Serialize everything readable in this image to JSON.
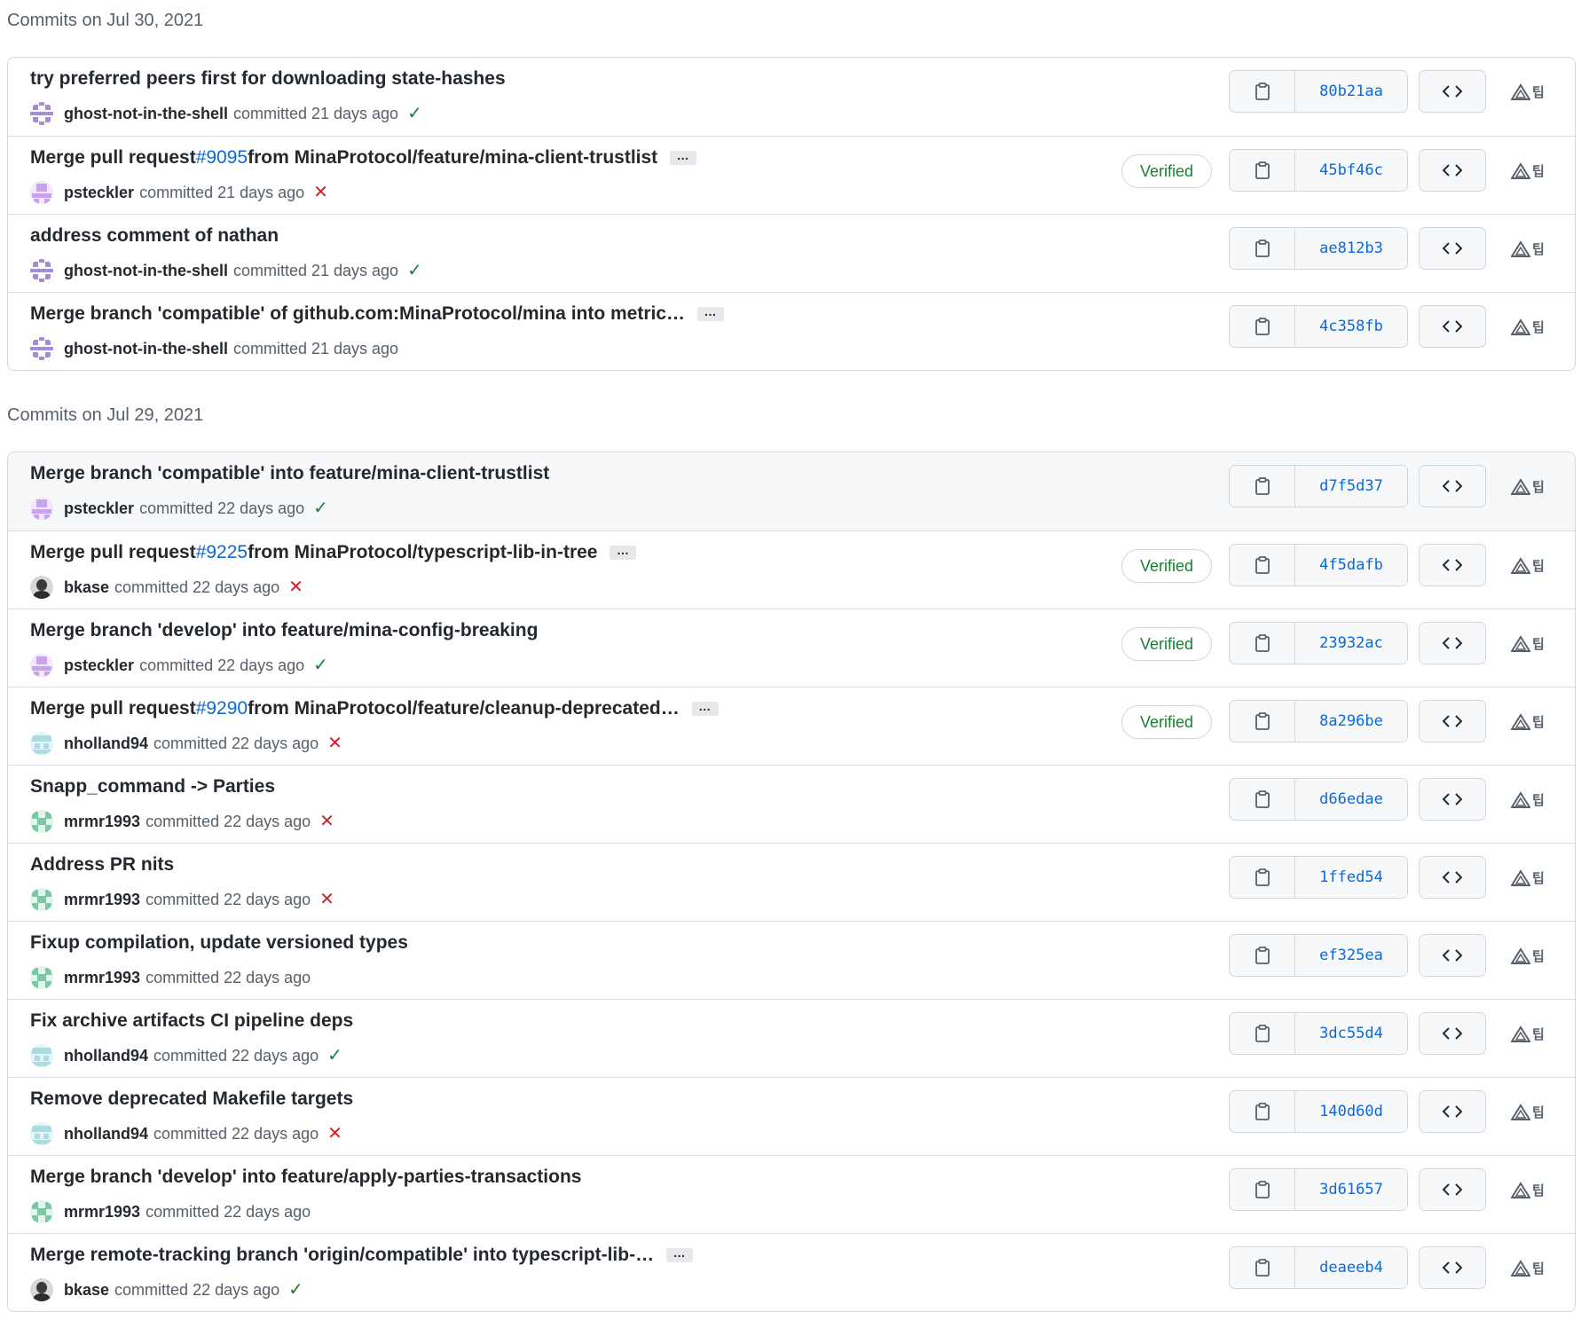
{
  "groups": [
    {
      "header": "Commits on Jul 30, 2021",
      "commits": [
        {
          "pre": "try preferred peers first for downloading state-hashes",
          "link": "",
          "post": "",
          "ellipsis": false,
          "author": "ghost-not-in-the-shell",
          "avatar": "ghost",
          "time": "committed 21 days ago",
          "status": "ok",
          "verified": false,
          "sha": "80b21aa",
          "highlight": false
        },
        {
          "pre": "Merge pull request ",
          "link": "#9095",
          "post": " from MinaProtocol/feature/mina-client-trustlist",
          "ellipsis": true,
          "author": "psteckler",
          "avatar": "psteck",
          "time": "committed 21 days ago",
          "status": "fail",
          "verified": true,
          "sha": "45bf46c",
          "highlight": false
        },
        {
          "pre": "address comment of nathan",
          "link": "",
          "post": "",
          "ellipsis": false,
          "author": "ghost-not-in-the-shell",
          "avatar": "ghost",
          "time": "committed 21 days ago",
          "status": "ok",
          "verified": false,
          "sha": "ae812b3",
          "highlight": false
        },
        {
          "pre": "Merge branch 'compatible' of github.com:MinaProtocol/mina into metric…",
          "link": "",
          "post": "",
          "ellipsis": true,
          "author": "ghost-not-in-the-shell",
          "avatar": "ghost",
          "time": "committed 21 days ago",
          "status": "none",
          "verified": false,
          "sha": "4c358fb",
          "highlight": false
        }
      ]
    },
    {
      "header": "Commits on Jul 29, 2021",
      "commits": [
        {
          "pre": "Merge branch 'compatible' into feature/mina-client-trustlist",
          "link": "",
          "post": "",
          "ellipsis": false,
          "author": "psteckler",
          "avatar": "psteck",
          "time": "committed 22 days ago",
          "status": "ok",
          "verified": false,
          "sha": "d7f5d37",
          "highlight": true
        },
        {
          "pre": "Merge pull request ",
          "link": "#9225",
          "post": " from MinaProtocol/typescript-lib-in-tree",
          "ellipsis": true,
          "author": "bkase",
          "avatar": "bkase",
          "time": "committed 22 days ago",
          "status": "fail",
          "verified": true,
          "sha": "4f5dafb",
          "highlight": false
        },
        {
          "pre": "Merge branch 'develop' into feature/mina-config-breaking",
          "link": "",
          "post": "",
          "ellipsis": false,
          "author": "psteckler",
          "avatar": "psteck",
          "time": "committed 22 days ago",
          "status": "ok",
          "verified": true,
          "sha": "23932ac",
          "highlight": false
        },
        {
          "pre": "Merge pull request ",
          "link": "#9290",
          "post": " from MinaProtocol/feature/cleanup-deprecated…",
          "ellipsis": true,
          "author": "nholland94",
          "avatar": "nholl",
          "time": "committed 22 days ago",
          "status": "fail",
          "verified": true,
          "sha": "8a296be",
          "highlight": false
        },
        {
          "pre": "Snapp_command -> Parties",
          "link": "",
          "post": "",
          "ellipsis": false,
          "author": "mrmr1993",
          "avatar": "mrmr",
          "time": "committed 22 days ago",
          "status": "fail",
          "verified": false,
          "sha": "d66edae",
          "highlight": false
        },
        {
          "pre": "Address PR nits",
          "link": "",
          "post": "",
          "ellipsis": false,
          "author": "mrmr1993",
          "avatar": "mrmr",
          "time": "committed 22 days ago",
          "status": "fail",
          "verified": false,
          "sha": "1ffed54",
          "highlight": false
        },
        {
          "pre": "Fixup compilation, update versioned types",
          "link": "",
          "post": "",
          "ellipsis": false,
          "author": "mrmr1993",
          "avatar": "mrmr",
          "time": "committed 22 days ago",
          "status": "none",
          "verified": false,
          "sha": "ef325ea",
          "highlight": false
        },
        {
          "pre": "Fix archive artifacts CI pipeline deps",
          "link": "",
          "post": "",
          "ellipsis": false,
          "author": "nholland94",
          "avatar": "nholl",
          "time": "committed 22 days ago",
          "status": "ok",
          "verified": false,
          "sha": "3dc55d4",
          "highlight": false
        },
        {
          "pre": "Remove deprecated Makefile targets",
          "link": "",
          "post": "",
          "ellipsis": false,
          "author": "nholland94",
          "avatar": "nholl",
          "time": "committed 22 days ago",
          "status": "fail",
          "verified": false,
          "sha": "140d60d",
          "highlight": false
        },
        {
          "pre": "Merge branch 'develop' into feature/apply-parties-transactions",
          "link": "",
          "post": "",
          "ellipsis": false,
          "author": "mrmr1993",
          "avatar": "mrmr",
          "time": "committed 22 days ago",
          "status": "none",
          "verified": false,
          "sha": "3d61657",
          "highlight": false
        },
        {
          "pre": "Merge remote-tracking branch 'origin/compatible' into typescript-lib-…",
          "link": "",
          "post": "",
          "ellipsis": true,
          "author": "bkase",
          "avatar": "bkase",
          "time": "committed 22 days ago",
          "status": "ok",
          "verified": false,
          "sha": "deaeeb4",
          "highlight": false
        }
      ]
    }
  ],
  "labels": {
    "verified": "Verified",
    "ellipsis": "…",
    "browse": "<>",
    "status_ok": "✓",
    "status_fail": "✕",
    "ext_icon_glyph": "팁"
  },
  "icons": {
    "copy": "clipboard-icon",
    "browse": "code-icon",
    "ext": "triangle-icon",
    "ok": "check-icon",
    "fail": "x-icon"
  },
  "colors": {
    "link": "#0969da",
    "success": "#1a7f37",
    "danger": "#cf222e",
    "border": "#d0d7de",
    "muted": "#57606a"
  }
}
